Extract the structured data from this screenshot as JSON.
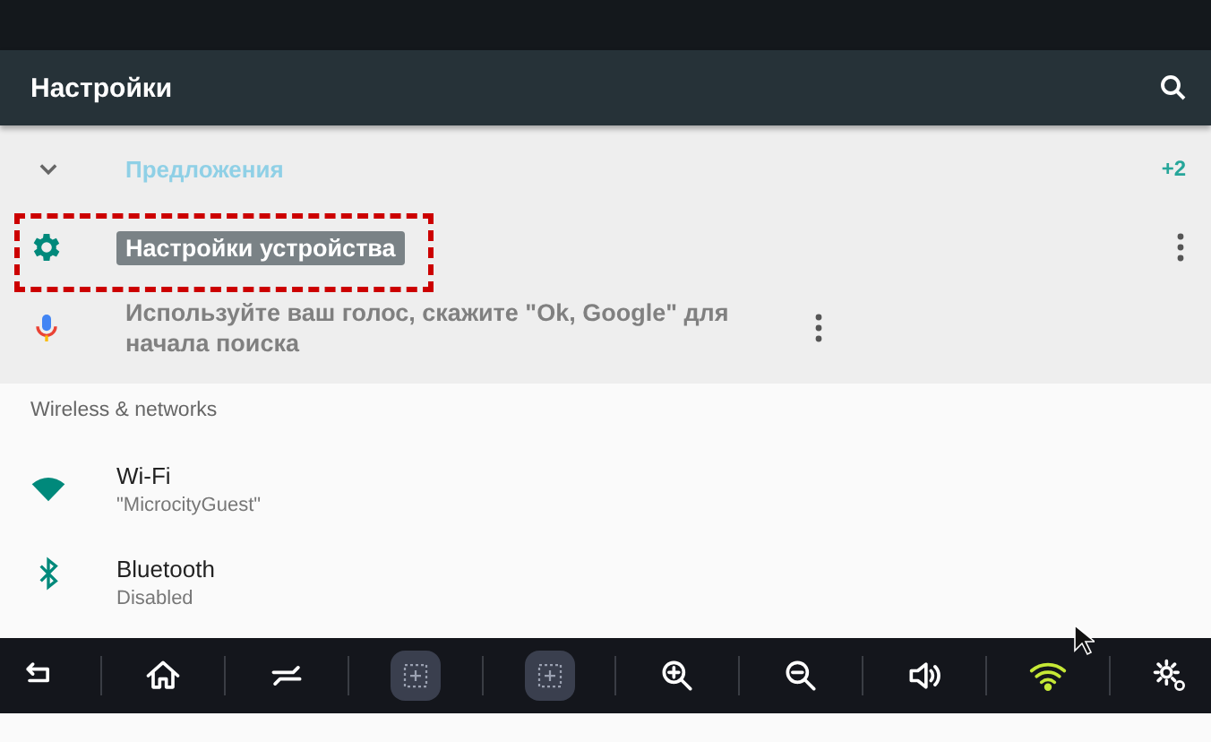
{
  "app_bar": {
    "title": "Настройки"
  },
  "suggestions": {
    "expanded": true,
    "title": "Предложения",
    "count": "+2",
    "items": [
      {
        "kind": "gear",
        "title": "Настройки устройства",
        "highlighted": true
      },
      {
        "kind": "mic",
        "title": "Используйте ваш голос, скажите \"Ok, Google\" для начала поиска",
        "highlighted": false
      }
    ]
  },
  "section": {
    "header": "Wireless & networks",
    "items": [
      {
        "kind": "wifi",
        "title": "Wi-Fi",
        "summary": "\"MicrocityGuest\""
      },
      {
        "kind": "bluetooth",
        "title": "Bluetooth",
        "summary": "Disabled"
      }
    ]
  },
  "nav_bar": {
    "buttons": [
      {
        "kind": "back"
      },
      {
        "kind": "home"
      },
      {
        "kind": "recents"
      },
      {
        "kind": "capture"
      },
      {
        "kind": "capture"
      },
      {
        "kind": "zoom-in"
      },
      {
        "kind": "zoom-out"
      },
      {
        "kind": "volume"
      },
      {
        "kind": "wifi"
      },
      {
        "kind": "settings"
      }
    ]
  }
}
